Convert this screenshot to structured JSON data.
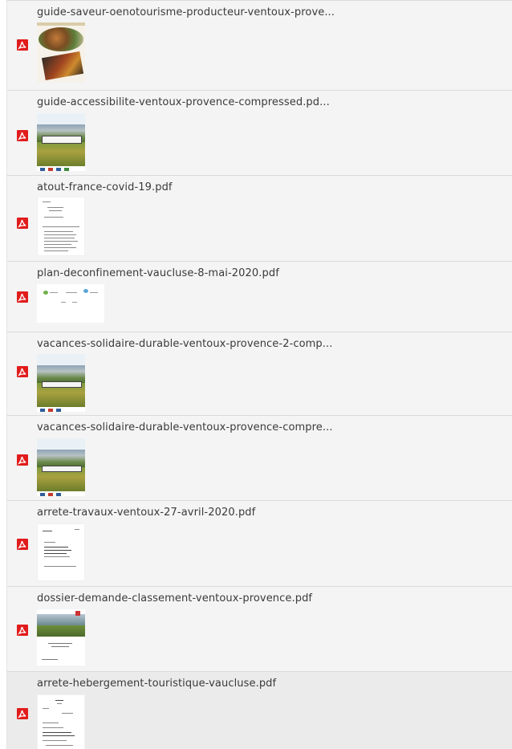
{
  "files": [
    {
      "name": "guide-saveur-oenotourisme-producteur-ventoux-prove...",
      "icon": "pdf-icon",
      "thumbnail": "guide-cover"
    },
    {
      "name": "guide-accessibilite-ventoux-provence-compressed.pd...",
      "icon": "pdf-icon",
      "thumbnail": "landscape-photo-cover"
    },
    {
      "name": "atout-france-covid-19.pdf",
      "icon": "pdf-icon",
      "thumbnail": "text-document"
    },
    {
      "name": "plan-deconfinement-vaucluse-8-mai-2020.pdf",
      "icon": "pdf-icon",
      "thumbnail": "landscape-document"
    },
    {
      "name": "vacances-solidaire-durable-ventoux-provence-2-comp...",
      "icon": "pdf-icon",
      "thumbnail": "landscape-photo-cover"
    },
    {
      "name": "vacances-solidaire-durable-ventoux-provence-compre...",
      "icon": "pdf-icon",
      "thumbnail": "landscape-photo-cover"
    },
    {
      "name": "arrete-travaux-ventoux-27-avril-2020.pdf",
      "icon": "pdf-icon",
      "thumbnail": "text-document"
    },
    {
      "name": "dossier-demande-classement-ventoux-provence.pdf",
      "icon": "pdf-icon",
      "thumbnail": "landscape-photo-cover"
    },
    {
      "name": "arrete-hebergement-touristique-vaucluse.pdf",
      "icon": "pdf-icon",
      "thumbnail": "text-document"
    }
  ],
  "colors": {
    "pdf_icon": "#e11c1c",
    "row_background": "#f4f4f4",
    "selected_row_background": "#ebebeb",
    "filename_text": "#3a3a3a",
    "divider": "#dadada"
  }
}
